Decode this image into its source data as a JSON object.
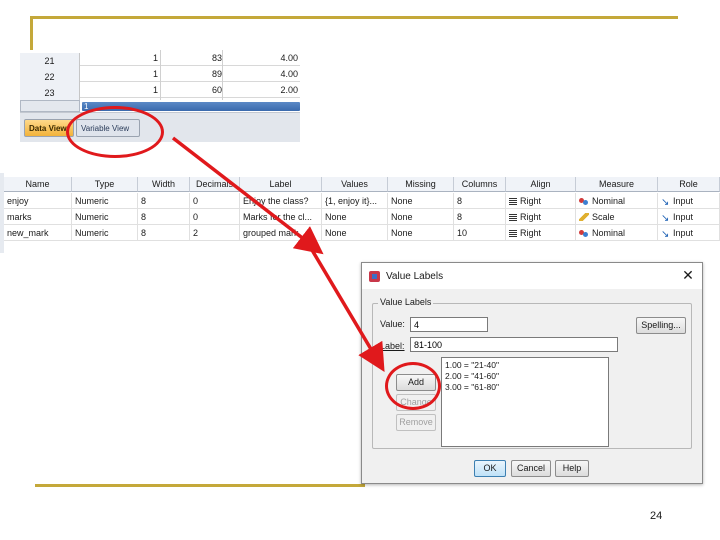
{
  "data_view": {
    "rows": [
      {
        "num": "21",
        "c1": "1",
        "c2": "83",
        "c3": "4.00"
      },
      {
        "num": "22",
        "c1": "1",
        "c2": "89",
        "c3": "4.00"
      },
      {
        "num": "23",
        "c1": "1",
        "c2": "60",
        "c3": "2.00"
      }
    ],
    "hscroll_label": "1",
    "tabs": {
      "data_view": "Data View",
      "variable_view": "Variable View"
    }
  },
  "variable_view": {
    "headers": [
      "Name",
      "Type",
      "Width",
      "Decimals",
      "Label",
      "Values",
      "Missing",
      "Columns",
      "Align",
      "Measure",
      "Role"
    ],
    "rows": [
      {
        "name": "enjoy",
        "type": "Numeric",
        "width": "8",
        "decimals": "0",
        "label": "Enjoy the class?",
        "values": "{1, enjoy it}...",
        "missing": "None",
        "columns": "8",
        "align": "Right",
        "measure": "Nominal",
        "role": "Input"
      },
      {
        "name": "marks",
        "type": "Numeric",
        "width": "8",
        "decimals": "0",
        "label": "Marks for the cl...",
        "values": "None",
        "missing": "None",
        "columns": "8",
        "align": "Right",
        "measure": "Scale",
        "role": "Input"
      },
      {
        "name": "new_mark",
        "type": "Numeric",
        "width": "8",
        "decimals": "2",
        "label": "grouped mark",
        "values": "None",
        "missing": "None",
        "columns": "10",
        "align": "Right",
        "measure": "Nominal",
        "role": "Input"
      }
    ]
  },
  "dialog": {
    "title": "Value Labels",
    "close_glyph": "✕",
    "group_label": "Value Labels",
    "value_label": "Value:",
    "value": "4",
    "label_label": "Label:",
    "label": "81-100",
    "spelling_button": "Spelling...",
    "list_items": [
      "1.00 = \"21-40\"",
      "2.00 = \"41-60\"",
      "3.00 = \"61-80\""
    ],
    "buttons": {
      "add": "Add",
      "change": "Change",
      "remove": "Remove",
      "ok": "OK",
      "cancel": "Cancel",
      "help": "Help"
    }
  },
  "annotations": {
    "color": "#e0191c"
  },
  "page_number": "24"
}
